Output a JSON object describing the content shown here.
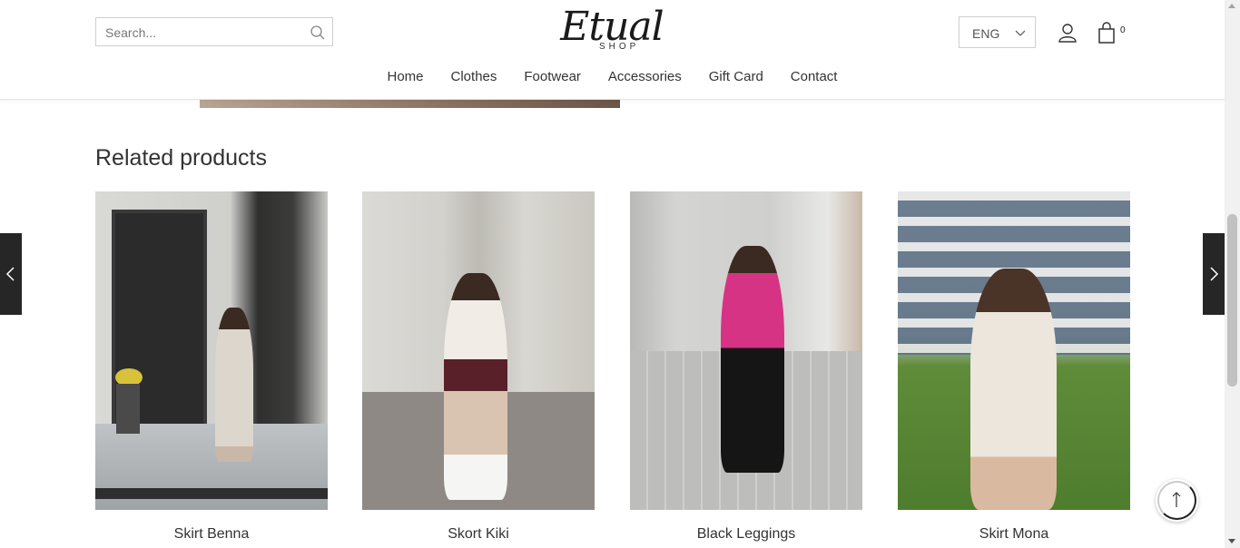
{
  "header": {
    "search_placeholder": "Search...",
    "logo_script": "Etual",
    "logo_sub": "SHOP",
    "language": "ENG",
    "cart_count": "0"
  },
  "nav": [
    {
      "label": "Home"
    },
    {
      "label": "Clothes"
    },
    {
      "label": "Footwear"
    },
    {
      "label": "Accessories"
    },
    {
      "label": "Gift Card"
    },
    {
      "label": "Contact"
    }
  ],
  "related": {
    "title": "Related products",
    "products": [
      {
        "name": "Skirt Benna"
      },
      {
        "name": "Skort Kiki"
      },
      {
        "name": "Black Leggings"
      },
      {
        "name": "Skirt Mona"
      }
    ]
  },
  "icons": {
    "search": "search-icon",
    "user": "user-icon",
    "cart": "cart-icon",
    "prev": "chevron-left-icon",
    "next": "chevron-right-icon",
    "scroll_top": "arrow-up-icon"
  }
}
